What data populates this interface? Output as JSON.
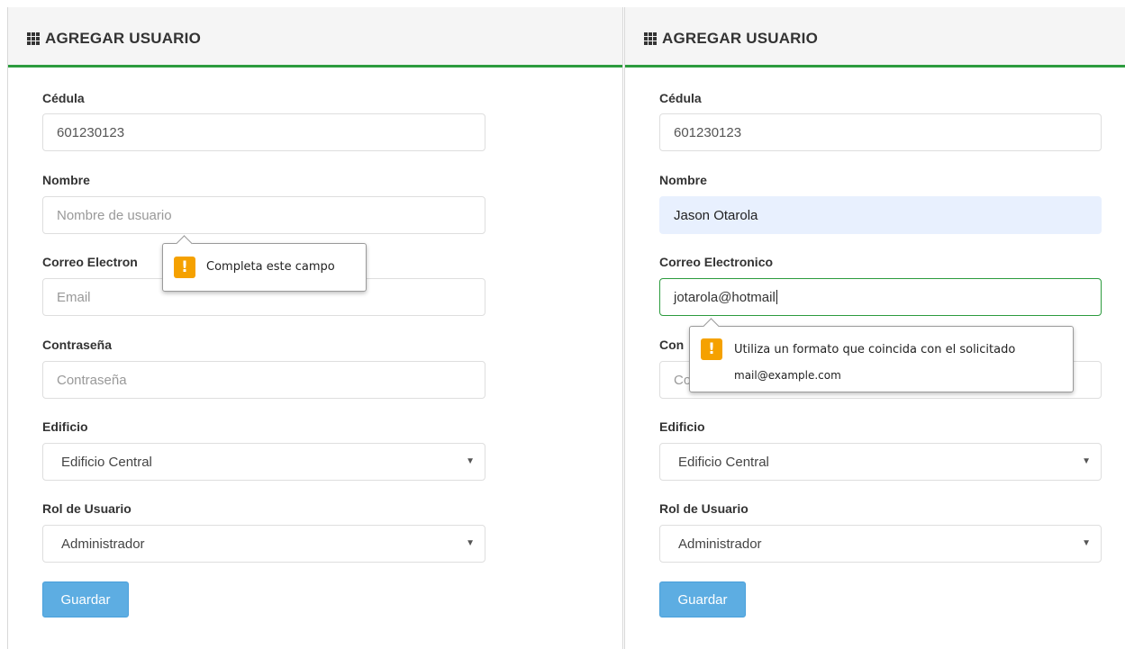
{
  "left": {
    "title": "AGREGAR USUARIO",
    "cedula": {
      "label": "Cédula",
      "value": "601230123"
    },
    "nombre": {
      "label": "Nombre",
      "placeholder": "Nombre de usuario"
    },
    "correo": {
      "label": "Correo Electron",
      "placeholder": "Email"
    },
    "contrasena": {
      "label": "Contraseña",
      "placeholder": "Contraseña"
    },
    "edificio": {
      "label": "Edificio",
      "selected": "Edificio Central"
    },
    "rol": {
      "label": "Rol de Usuario",
      "selected": "Administrador"
    },
    "save_label": "Guardar",
    "tooltip": {
      "message": "Completa este campo"
    }
  },
  "right": {
    "title": "AGREGAR USUARIO",
    "cedula": {
      "label": "Cédula",
      "value": "601230123"
    },
    "nombre": {
      "label": "Nombre",
      "value": "Jason Otarola"
    },
    "correo": {
      "label": "Correo Electronico",
      "value": "jotarola@hotmail"
    },
    "contrasena": {
      "label": "Con",
      "placeholder": "Co"
    },
    "edificio": {
      "label": "Edificio",
      "selected": "Edificio Central"
    },
    "rol": {
      "label": "Rol de Usuario",
      "selected": "Administrador"
    },
    "save_label": "Guardar",
    "tooltip": {
      "message": "Utiliza un formato que coincida con el solicitado",
      "hint": "mail@example.com"
    }
  },
  "icons": {
    "header": "th-grid-icon",
    "warning": "exclamation-icon",
    "dropdown": "caret-down-icon"
  },
  "colors": {
    "header_border": "#2c9b3e",
    "button": "#5dade2",
    "warning": "#f5a100",
    "autofill": "#e8f0fe"
  }
}
